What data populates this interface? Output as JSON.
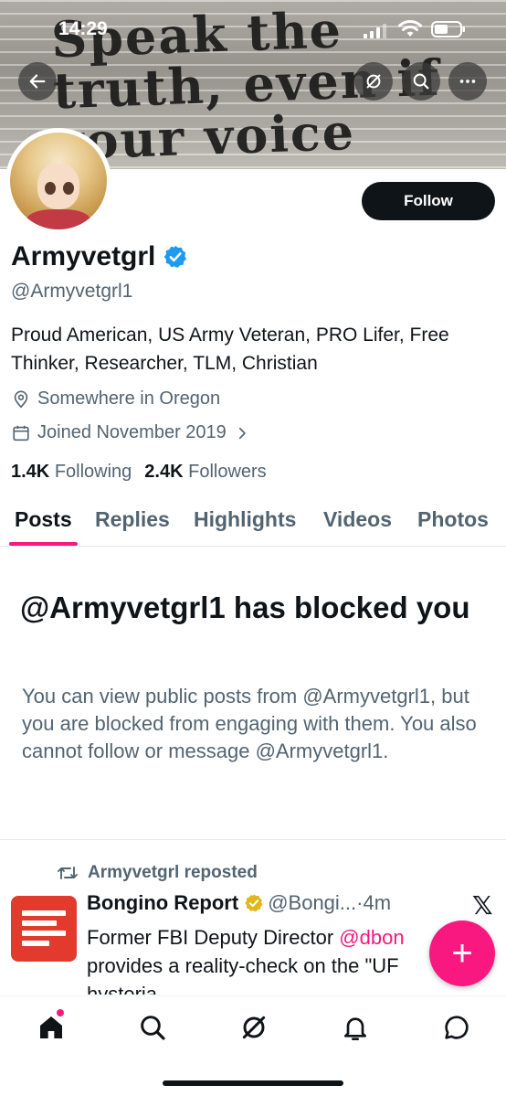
{
  "status_bar": {
    "time": "14:29"
  },
  "banner": {
    "graffiti_lines": [
      "Speak the",
      "truth, even if",
      "your voice"
    ]
  },
  "profile": {
    "follow_label": "Follow",
    "name": "Armyvetgrl",
    "handle": "@Armyvetgrl1",
    "bio": "Proud American, US Army Veteran, PRO Lifer, Free Thinker, Researcher, TLM, Christian",
    "location": "Somewhere in Oregon",
    "joined": "Joined November 2019",
    "following_count": "1.4K",
    "following_label": "Following",
    "followers_count": "2.4K",
    "followers_label": "Followers"
  },
  "tabs": [
    {
      "label": "Posts",
      "active": true
    },
    {
      "label": "Replies",
      "active": false
    },
    {
      "label": "Highlights",
      "active": false
    },
    {
      "label": "Videos",
      "active": false
    },
    {
      "label": "Photos",
      "active": false
    }
  ],
  "blocked_notice": {
    "title": "@Armyvetgrl1 has blocked you",
    "body": "You can view public posts from @Armyvetgrl1, but you are blocked from engaging with them. You also cannot follow or message @Armyvetgrl1."
  },
  "post": {
    "repost_label": "Armyvetgrl reposted",
    "author_name": "Bongino Report",
    "author_handle": "@Bongi...",
    "time": "·4m",
    "text_before": "Former FBI Deputy Director ",
    "mention": "@dbon",
    "text_line2": "provides a reality-check on the \"UF",
    "text_line3": "hysteria."
  },
  "fab": {
    "label": "+"
  },
  "icons": {
    "back": "back-arrow-icon",
    "grok": "grok-icon",
    "search": "search-icon",
    "more": "more-icon",
    "verified": "verified-badge-icon",
    "location": "location-pin-icon",
    "calendar": "calendar-icon",
    "chevron": "chevron-right-icon",
    "repost": "repost-icon",
    "x_logo": "x-logo-icon",
    "nav": [
      "home-icon",
      "search-icon",
      "grok-icon",
      "notifications-icon",
      "messages-icon"
    ]
  },
  "colors": {
    "accent_pink": "#f91880",
    "verified_blue": "#1d9bf0",
    "gold_badge": "#e2b719",
    "text_primary": "#0f1419",
    "text_secondary": "#536471"
  }
}
